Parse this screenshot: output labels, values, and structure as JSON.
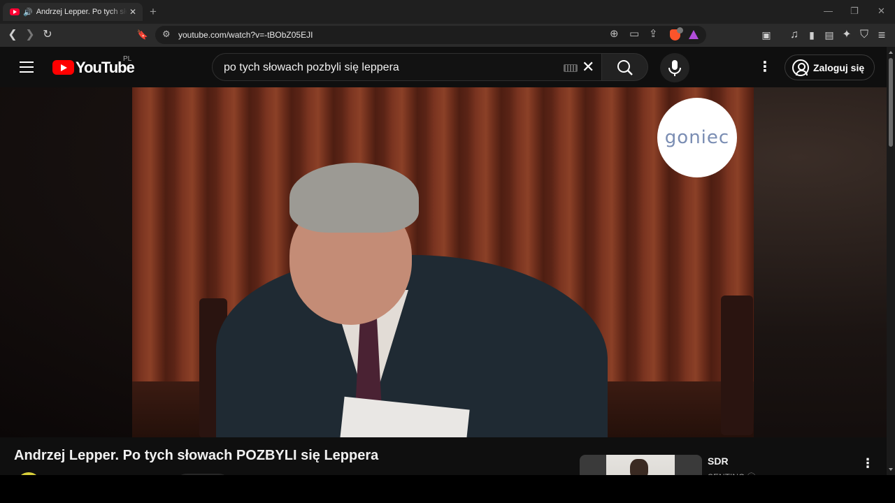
{
  "browser": {
    "tab": {
      "title": "Andrzej Lepper. Po tych słowach POZBYLI się Leppera - YouTube",
      "audio_icon": "🔊",
      "close": "✕"
    },
    "new_tab": "+",
    "window_controls": {
      "minimize": "—",
      "restore": "❐",
      "close": "✕"
    },
    "url": "youtube.com/watch?v=-tBObZ05EJI",
    "icons": {
      "back": "❮",
      "forward": "❯",
      "reload": "↻",
      "bookmark": "🔖",
      "site_info": "⚙",
      "zoom": "⊕",
      "cast": "▭",
      "share": "⇪",
      "screenshot": "▣",
      "media": "♫",
      "sidebar": "▮",
      "wallet": "▤",
      "leo": "✦",
      "vpn": "⛉",
      "menu": "≡"
    }
  },
  "youtube": {
    "logo_text": "YouTube",
    "country_code": "PL",
    "search": {
      "query": "po tych słowach pozbyli się leppera",
      "clear": "✕"
    },
    "more": "⋮",
    "signin_label": "Zaloguj się",
    "player": {
      "channel_watermark": "goniec"
    },
    "video_title": "Andrzej Lepper. Po tych słowach POZBYLI się Leppera",
    "recommendation": {
      "title": "SDR",
      "channel": "SENTINO ⓥ",
      "more": "⋮"
    }
  },
  "colors": {
    "brand_red": "#ff0000",
    "page_bg": "#0f0f0f",
    "toolbar_bg": "#2b2b2b"
  }
}
